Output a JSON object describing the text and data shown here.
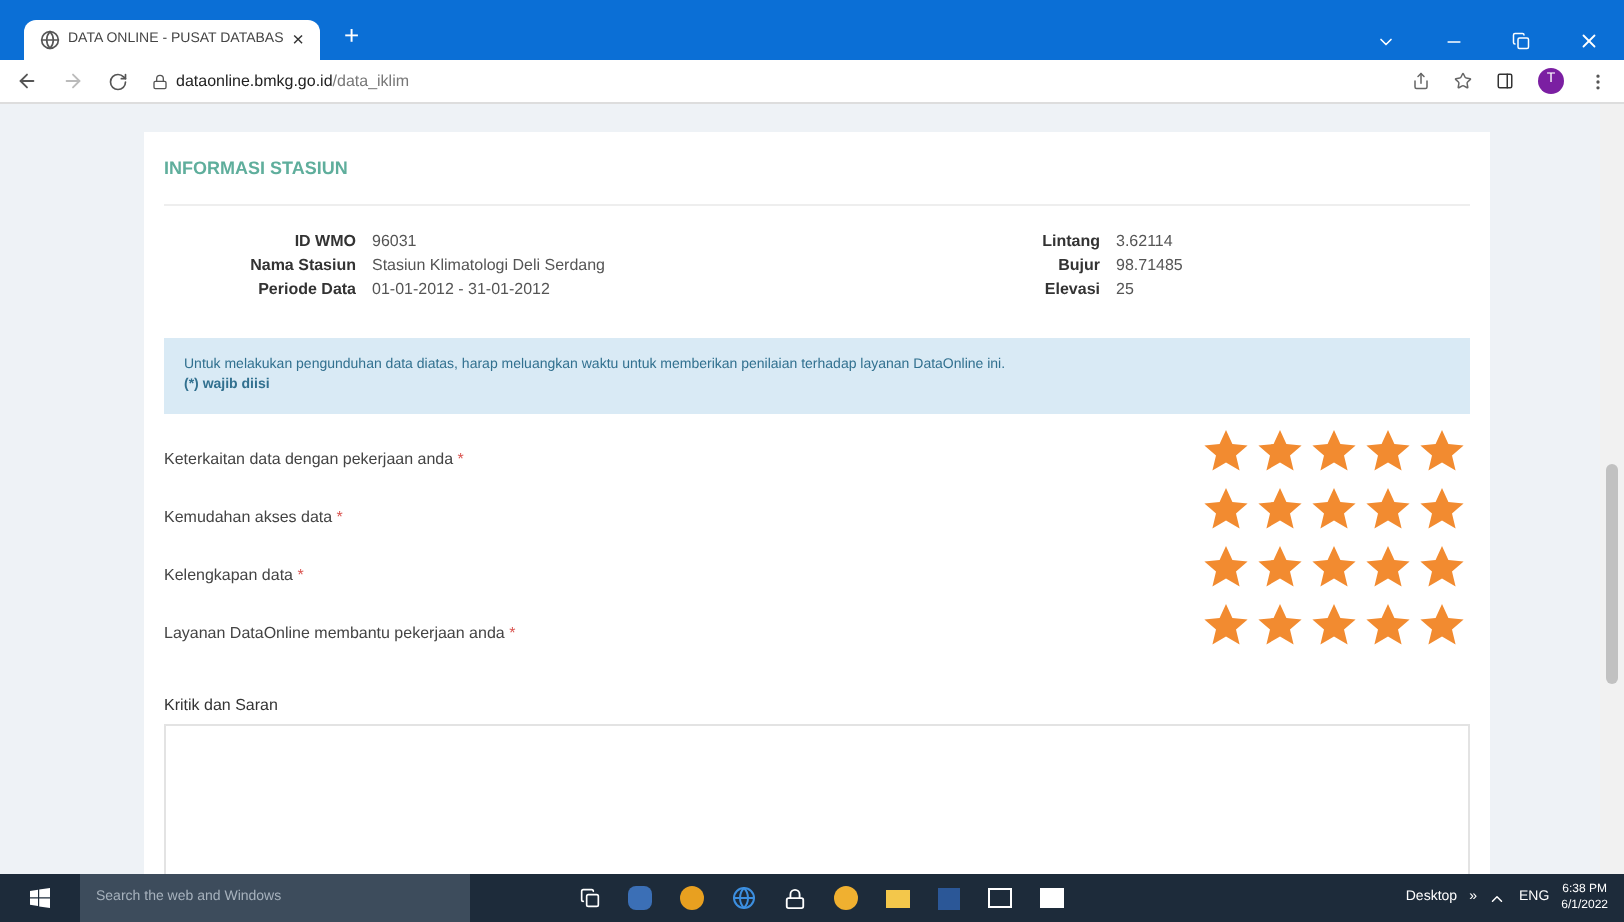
{
  "browser": {
    "tab_title": "DATA ONLINE - PUSAT DATABAS",
    "tab_close": "×",
    "new_tab": "+",
    "url_host": "dataonline.bmkg.go.id",
    "url_path": "/data_iklim",
    "profile_initial": "T"
  },
  "station_info": {
    "title": "INFORMASI STASIUN",
    "left_fields": [
      {
        "label": "ID WMO",
        "value": "96031"
      },
      {
        "label": "Nama Stasiun",
        "value": "Stasiun Klimatologi Deli Serdang"
      },
      {
        "label": "Periode Data",
        "value": "01-01-2012 - 31-01-2012"
      }
    ],
    "right_fields": [
      {
        "label": "Lintang",
        "value": "3.62114"
      },
      {
        "label": "Bujur",
        "value": "98.71485"
      },
      {
        "label": "Elevasi",
        "value": "25"
      }
    ],
    "notice": {
      "text": "Untuk melakukan pengunduhan data diatas, harap meluangkan waktu untuk memberikan penilaian terhadap layanan DataOnline ini.",
      "note": "(*) wajib diisi"
    },
    "ratings": [
      {
        "label": "Keterkaitan data dengan pekerjaan anda",
        "required": "*",
        "stars": 5
      },
      {
        "label": "Kemudahan akses data",
        "required": "*",
        "stars": 5
      },
      {
        "label": "Kelengkapan data",
        "required": "*",
        "stars": 5
      },
      {
        "label": "Layanan DataOnline membantu pekerjaan anda",
        "required": "*",
        "stars": 5
      }
    ],
    "feedback": {
      "label": "Kritik dan Saran"
    }
  },
  "taskbar": {
    "search_placeholder": "Search the web and Windows",
    "desktop_label": "Desktop",
    "chevron": "»",
    "language": "ENG",
    "time": "6:38 PM",
    "date": "6/1/2022"
  }
}
